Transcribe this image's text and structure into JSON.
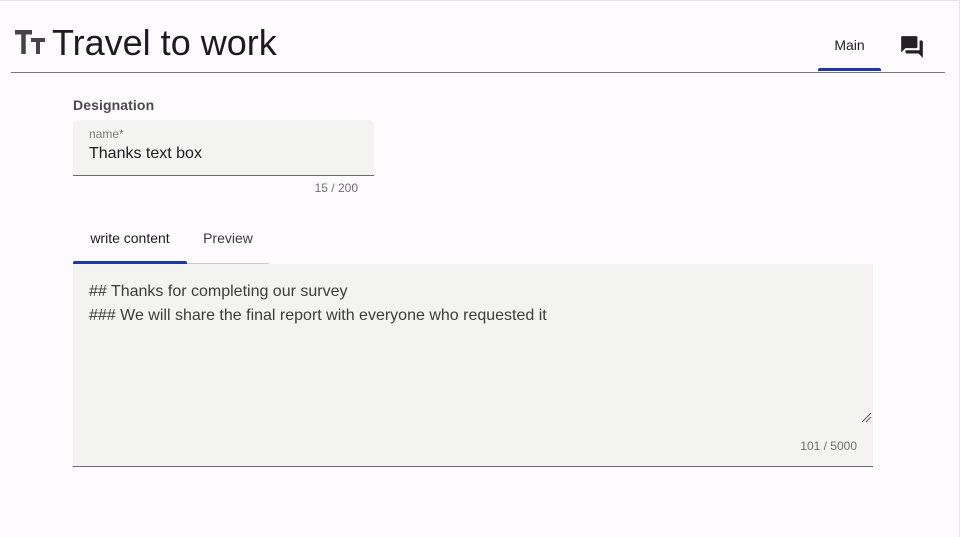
{
  "header": {
    "title": "Travel to work",
    "title_icon": "text-fields-icon",
    "tab_main_label": "Main",
    "chat_icon": "forum-icon"
  },
  "designation": {
    "section_label": "Designation",
    "name_label": "name*",
    "name_value": "Thanks text box",
    "name_counter": "15 / 200"
  },
  "content": {
    "tabs": [
      {
        "label": "write content",
        "selected": true
      },
      {
        "label": "Preview",
        "selected": false
      }
    ],
    "lines": [
      "## Thanks for completing our survey",
      "### We will share the final report with everyone who requested it"
    ],
    "counter": "101 / 5000"
  },
  "colors": {
    "accent": "#2036a6",
    "field_background": "#f3f4f2",
    "page_background": "#fefbfe"
  }
}
